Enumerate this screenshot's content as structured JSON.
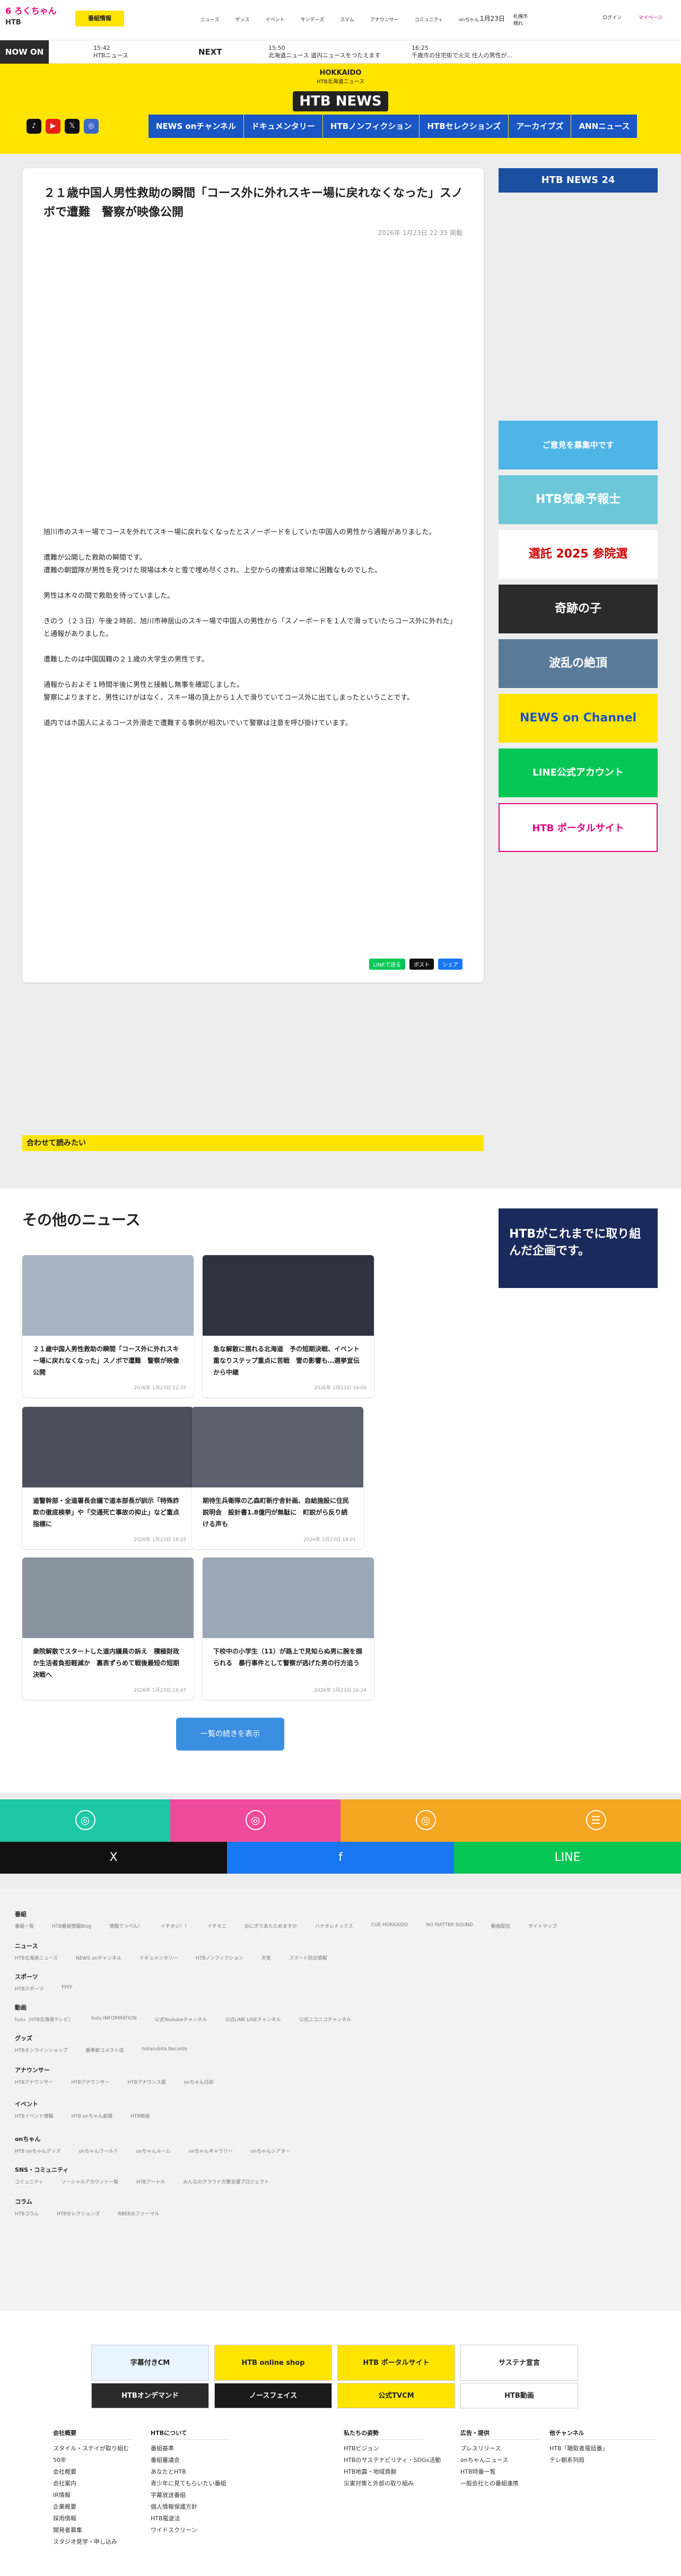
{
  "header": {
    "logo_line1": "6 ろくちゃん",
    "logo_line2": "HTB",
    "kyoku_btn": "番組情報",
    "nav": [
      "ニュース",
      "ゲッス",
      "イベント",
      "サンデーズ",
      "スマム",
      "アナウンサー",
      "コミュニティ",
      "onちゃん"
    ],
    "date": "1月23日",
    "weather": "札幌市\n晴れ",
    "login": "ログイン",
    "mypage": "マイページ"
  },
  "onair": {
    "label": "NOW ON AIR",
    "now_time": "15:42",
    "now_prog": "HTBニュース",
    "next_label": "NEXT",
    "next_time": "15:50",
    "next_prog": "北海道ニュース 道内ニュースをつたえます",
    "next2_time": "16:25",
    "next2_prog": "千歳市の住宅街で火災 住人の男性が…"
  },
  "brand": {
    "hokkaido": "HOKKAIDO",
    "sub": "HTB北海道ニュース",
    "name": "HTB NEWS"
  },
  "social": [
    "TikTok",
    "YouTube",
    "X",
    "Instagram"
  ],
  "subnav": [
    "NEWS onチャンネル",
    "ドキュメンタリー",
    "HTBノンフィクション",
    "HTBセレクションズ",
    "アーカイブズ",
    "ANNニュース"
  ],
  "article": {
    "title": "２１歳中国人男性救助の瞬間「コース外に外れスキー場に戻れなくなった」スノボで遭難　警察が映像公開",
    "published": "2026年 1月23日 22:35 掲載",
    "paragraphs": [
      "旭川市のスキー場でコースを外れてスキー場に戻れなくなったとスノーボードをしていた中国人の男性から通報がありました。",
      "遭難が公開した救助の瞬間です。\n遭難の朝盟隊が男性を見つけた現場は木々と雪で埋め尽くされ、上空からの捜索は非常に困難なものでした。",
      "男性は木々の間で救助を待っていました。",
      "きのう（２３日）午後２時前、旭川市神居山のスキー場で中国人の男性から「スノーボードを１人で滑っていたらコース外に外れた」と通報がありました。",
      "遭難したのは中国国籍の２１歳の大学生の男性です。",
      "通報からおよそ１時間半後に男性と接触し無事を確認しました。\n警察によりますと、男性にけがはなく、スキー場の頂上から１人で滑りていてコース外に出てしまったということです。",
      "道内ではホ国人によるコース外滑走で遭難する事例が相次いでいて警察は注意を呼び掛けています。"
    ],
    "share": [
      "LINEで送る",
      "ポスト",
      "シェア"
    ]
  },
  "related": "合わせて読みたい",
  "right_banners": [
    "HTB NEWS 24",
    "ご意見を募集中です",
    "HTB気象予報士",
    "選託 2025 参院選",
    "奇跡の子",
    "波乱の絶頂",
    "NEWS on Channel",
    "LINE公式アカウント",
    "HTB ポータルサイト"
  ],
  "other_news": {
    "heading": "その他のニュース",
    "cards": [
      {
        "title": "２１歳中国人男性救助の瞬間「コース外に外れスキー場に戻れなくなった」スノボで遭難　警察が映像公開",
        "date": "2026年 1月23日 22:35"
      },
      {
        "title": "急な解散に揺れる北海道　予の短期決戦、イベント重なりステップ重点に苦戦　雪の影響も…選挙宣伝から中継",
        "date": "2026年 1月23日 19:00"
      },
      {
        "title": "道警幹部・全道署長会議で道本部長が訓示「特殊詐欺の徹底検挙」や「交通死亡事故の抑止」など重点指標に",
        "date": "2026年 1月23日 18:25"
      },
      {
        "title": "期待生兵衛隊の乙森町新庁舎計画、自給施設に住民説明会　設計書1.8億円が無駄に　町説がら反り続ける声も",
        "date": "2026年 1月23日 18:01"
      },
      {
        "title": "衆院解散でスタートした道内議員の訴え　積極財政か生活者負担軽減か　裏表ずらめて戦後最短の短期決戦へ",
        "date": "2026年 1月23日 18:47"
      },
      {
        "title": "下校中の小学生（11）が路上で見知らぬ男に腕を掴られる　暴行事件として警察が逃げた男の行方追う",
        "date": "2026年 1月23日 16:24"
      }
    ],
    "more": "一覧の続きを表示",
    "side_banner": "HTBがこれまでに取り組んだ企画です。"
  },
  "footer": {
    "share": [
      "X",
      "f",
      "LINE"
    ],
    "sections": [
      {
        "h": "番組",
        "l": [
          "番組一覧",
          "HTB番組情報Blog",
          "情報てっぺん！",
          "イチオシ！！",
          "イチモニ",
          "おにぎりあたためますか",
          "ハナタレナックス",
          "CUE HOKKAIDO",
          "NO MATTER SOUND",
          "動画配信",
          "サイトマップ"
        ]
      },
      {
        "h": "ニュース",
        "l": [
          "HTB北海道ニュース",
          "NEWS onチャンネル",
          "ドキュメンタリー",
          "HTBノンフィクション",
          "天気",
          "スマート防災情報"
        ]
      },
      {
        "h": "スポーツ",
        "l": [
          "HTBスポーツ",
          "FFFF"
        ]
      },
      {
        "h": "動画",
        "l": [
          "hulu（HTB北海道テレビ）",
          "hulu INFORMATION",
          "公式Youtubeチャンネル",
          "公式LINE LIVEチャンネル",
          "公式ニコニコチャンネル"
        ]
      },
      {
        "h": "グッズ",
        "l": [
          "HTBオンラインショップ",
          "番季節コメスト店",
          "hotarubita Records"
        ]
      },
      {
        "h": "アナウンサー",
        "l": [
          "HTBアナウンサー",
          "HTBアナウンサー",
          "HTBアナウンス部",
          "onちゃん日誌"
        ]
      },
      {
        "h": "イベント",
        "l": [
          "HTBイベント情報",
          "HTB onちゃん劇場",
          "HTB映画"
        ]
      },
      {
        "h": "onちゃん",
        "l": [
          "HTB onちゃんグッズ",
          "onちゃんワールド",
          "onちゃんルーム",
          "onちゃんギャラリー",
          "onちゃんシアター"
        ]
      },
      {
        "h": "SNS・コミュニティ",
        "l": [
          "コミュニティ",
          "ソーシャルアカウント一覧",
          "HTBアートル",
          "みんなのクラウド方策支援プロジェクト"
        ]
      },
      {
        "h": "コラム",
        "l": [
          "HTBコラム",
          "HTBセレクションズ",
          "RBEEのファーマル"
        ]
      }
    ],
    "bottom_banners": [
      "字幕付きCM",
      "HTB online shop",
      "HTB ポータルサイト",
      "サステナ宣言",
      "HTBオンデマンド",
      "ノースフェイス",
      "公式TVCM",
      "HTB動画"
    ],
    "cols": [
      {
        "h": "会社概要",
        "l": [
          "スタイル・ステイが取り組む",
          "50年",
          "会社概要",
          "会社案内",
          "IR情報",
          "企業概要",
          "採用情報",
          "開発者募集",
          "スタジオ見学・申し込み"
        ]
      },
      {
        "h": "HTBについて",
        "l": [
          "番組基準",
          "番組審議会",
          "あなたとHTB",
          "青少年に見てもらいたい番組",
          "字幕放送番組",
          "個人情報保護方針",
          "HTB電波法",
          "ワイドスクリーン"
        ]
      },
      {
        "h": "私たちの姿勢",
        "l": [
          "HTBビジョン",
          "HTBのサステナビリティ・SDGs活動",
          "HTB地震・地域貢献",
          "災害対策と外部の取り組み"
        ]
      },
      {
        "h": "広告・提供",
        "l": [
          "プレスリリース",
          "onちゃんニュース",
          "HTB特番一覧",
          "一般会社との番組連携"
        ]
      },
      {
        "h": "他チャンネル",
        "l": [
          "HTB「聴取者電話番」",
          "テレ朝系列局"
        ]
      }
    ]
  }
}
